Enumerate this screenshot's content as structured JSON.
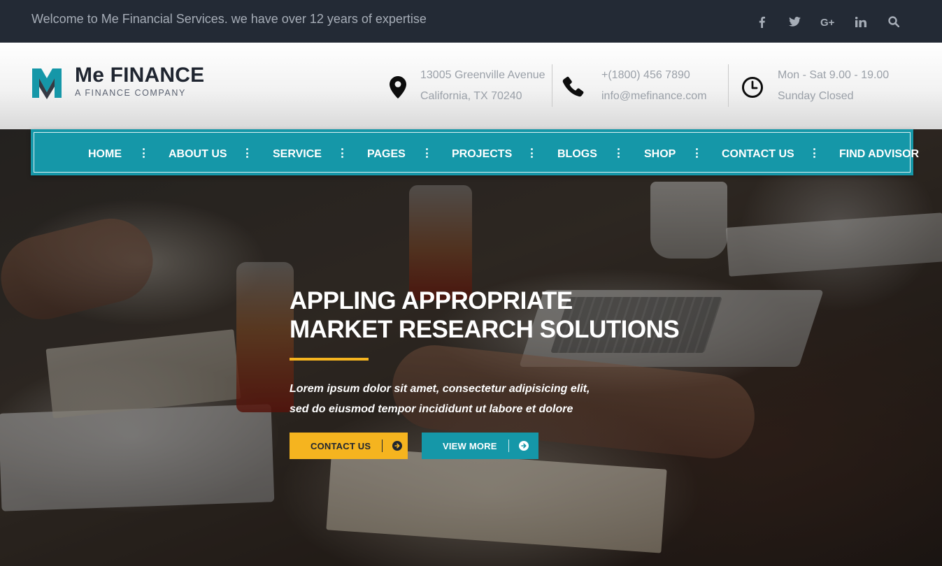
{
  "topbar": {
    "welcome_text": "Welcome to Me Financial Services. we have over 12 years of expertise",
    "social": [
      {
        "icon": "facebook-icon",
        "glyph": "f"
      },
      {
        "icon": "twitter-icon",
        "glyph": "t"
      },
      {
        "icon": "google-plus-icon",
        "glyph": "G+"
      },
      {
        "icon": "linkedin-icon",
        "glyph": "in"
      },
      {
        "icon": "search-icon",
        "glyph": "search"
      }
    ]
  },
  "header": {
    "brand": {
      "name": "Me FINANCE",
      "tagline": "A FINANCE COMPANY",
      "color": "#1597a8"
    },
    "address": {
      "icon": "location-pin-icon",
      "line1": "13005 Greenville Avenue",
      "line2": "California, TX 70240"
    },
    "contact": {
      "icon": "phone-icon",
      "line1": "+(1800) 456 7890",
      "line2": "info@mefinance.com"
    },
    "hours": {
      "icon": "clock-icon",
      "line1": "Mon - Sat 9.00 - 19.00",
      "line2": "Sunday Closed"
    }
  },
  "nav": {
    "items": [
      {
        "label": "HOME"
      },
      {
        "label": "ABOUT US"
      },
      {
        "label": "SERVICE"
      },
      {
        "label": "PAGES"
      },
      {
        "label": "PROJECTS"
      },
      {
        "label": "BLOGS"
      },
      {
        "label": "SHOP"
      },
      {
        "label": "CONTACT US"
      },
      {
        "label": "FIND ADVISOR"
      }
    ],
    "color": "#1597a8"
  },
  "hero": {
    "title_line1": "APPLING APPROPRIATE",
    "title_line2": "MARKET RESEARCH SOLUTIONS",
    "subtitle_line1": "Lorem ipsum dolor sit amet, consectetur adipisicing elit,",
    "subtitle_line2": "sed do eiusmod tempor incididunt ut labore et dolore",
    "accent_color": "#f5b41f",
    "buttons": {
      "contact_label": "CONTACT US",
      "view_more_label": "VIEW MORE",
      "arrow_icon": "arrow-right-circle-icon"
    }
  }
}
